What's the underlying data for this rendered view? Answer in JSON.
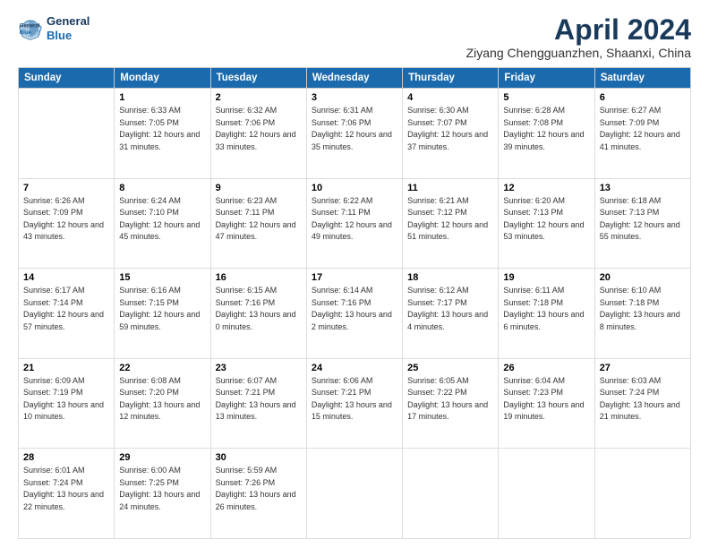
{
  "header": {
    "logo_line1": "General",
    "logo_line2": "Blue",
    "month": "April 2024",
    "location": "Ziyang Chengguanzhen, Shaanxi, China"
  },
  "weekdays": [
    "Sunday",
    "Monday",
    "Tuesday",
    "Wednesday",
    "Thursday",
    "Friday",
    "Saturday"
  ],
  "weeks": [
    [
      {
        "day": null
      },
      {
        "day": "1",
        "sunrise": "6:33 AM",
        "sunset": "7:05 PM",
        "daylight": "12 hours and 31 minutes."
      },
      {
        "day": "2",
        "sunrise": "6:32 AM",
        "sunset": "7:06 PM",
        "daylight": "12 hours and 33 minutes."
      },
      {
        "day": "3",
        "sunrise": "6:31 AM",
        "sunset": "7:06 PM",
        "daylight": "12 hours and 35 minutes."
      },
      {
        "day": "4",
        "sunrise": "6:30 AM",
        "sunset": "7:07 PM",
        "daylight": "12 hours and 37 minutes."
      },
      {
        "day": "5",
        "sunrise": "6:28 AM",
        "sunset": "7:08 PM",
        "daylight": "12 hours and 39 minutes."
      },
      {
        "day": "6",
        "sunrise": "6:27 AM",
        "sunset": "7:09 PM",
        "daylight": "12 hours and 41 minutes."
      }
    ],
    [
      {
        "day": "7",
        "sunrise": "6:26 AM",
        "sunset": "7:09 PM",
        "daylight": "12 hours and 43 minutes."
      },
      {
        "day": "8",
        "sunrise": "6:24 AM",
        "sunset": "7:10 PM",
        "daylight": "12 hours and 45 minutes."
      },
      {
        "day": "9",
        "sunrise": "6:23 AM",
        "sunset": "7:11 PM",
        "daylight": "12 hours and 47 minutes."
      },
      {
        "day": "10",
        "sunrise": "6:22 AM",
        "sunset": "7:11 PM",
        "daylight": "12 hours and 49 minutes."
      },
      {
        "day": "11",
        "sunrise": "6:21 AM",
        "sunset": "7:12 PM",
        "daylight": "12 hours and 51 minutes."
      },
      {
        "day": "12",
        "sunrise": "6:20 AM",
        "sunset": "7:13 PM",
        "daylight": "12 hours and 53 minutes."
      },
      {
        "day": "13",
        "sunrise": "6:18 AM",
        "sunset": "7:13 PM",
        "daylight": "12 hours and 55 minutes."
      }
    ],
    [
      {
        "day": "14",
        "sunrise": "6:17 AM",
        "sunset": "7:14 PM",
        "daylight": "12 hours and 57 minutes."
      },
      {
        "day": "15",
        "sunrise": "6:16 AM",
        "sunset": "7:15 PM",
        "daylight": "12 hours and 59 minutes."
      },
      {
        "day": "16",
        "sunrise": "6:15 AM",
        "sunset": "7:16 PM",
        "daylight": "13 hours and 0 minutes."
      },
      {
        "day": "17",
        "sunrise": "6:14 AM",
        "sunset": "7:16 PM",
        "daylight": "13 hours and 2 minutes."
      },
      {
        "day": "18",
        "sunrise": "6:12 AM",
        "sunset": "7:17 PM",
        "daylight": "13 hours and 4 minutes."
      },
      {
        "day": "19",
        "sunrise": "6:11 AM",
        "sunset": "7:18 PM",
        "daylight": "13 hours and 6 minutes."
      },
      {
        "day": "20",
        "sunrise": "6:10 AM",
        "sunset": "7:18 PM",
        "daylight": "13 hours and 8 minutes."
      }
    ],
    [
      {
        "day": "21",
        "sunrise": "6:09 AM",
        "sunset": "7:19 PM",
        "daylight": "13 hours and 10 minutes."
      },
      {
        "day": "22",
        "sunrise": "6:08 AM",
        "sunset": "7:20 PM",
        "daylight": "13 hours and 12 minutes."
      },
      {
        "day": "23",
        "sunrise": "6:07 AM",
        "sunset": "7:21 PM",
        "daylight": "13 hours and 13 minutes."
      },
      {
        "day": "24",
        "sunrise": "6:06 AM",
        "sunset": "7:21 PM",
        "daylight": "13 hours and 15 minutes."
      },
      {
        "day": "25",
        "sunrise": "6:05 AM",
        "sunset": "7:22 PM",
        "daylight": "13 hours and 17 minutes."
      },
      {
        "day": "26",
        "sunrise": "6:04 AM",
        "sunset": "7:23 PM",
        "daylight": "13 hours and 19 minutes."
      },
      {
        "day": "27",
        "sunrise": "6:03 AM",
        "sunset": "7:24 PM",
        "daylight": "13 hours and 21 minutes."
      }
    ],
    [
      {
        "day": "28",
        "sunrise": "6:01 AM",
        "sunset": "7:24 PM",
        "daylight": "13 hours and 22 minutes."
      },
      {
        "day": "29",
        "sunrise": "6:00 AM",
        "sunset": "7:25 PM",
        "daylight": "13 hours and 24 minutes."
      },
      {
        "day": "30",
        "sunrise": "5:59 AM",
        "sunset": "7:26 PM",
        "daylight": "13 hours and 26 minutes."
      },
      {
        "day": null
      },
      {
        "day": null
      },
      {
        "day": null
      },
      {
        "day": null
      }
    ]
  ],
  "labels": {
    "sunrise": "Sunrise:",
    "sunset": "Sunset:",
    "daylight": "Daylight:"
  }
}
